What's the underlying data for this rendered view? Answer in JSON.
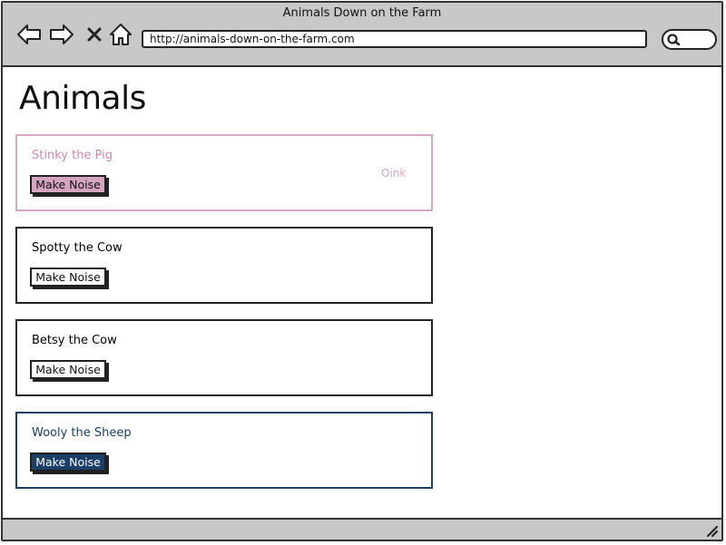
{
  "window": {
    "title": "Animals Down on the Farm"
  },
  "toolbar": {
    "back_icon": "back-arrow-icon",
    "forward_icon": "forward-arrow-icon",
    "stop_icon": "close-icon",
    "home_icon": "home-icon",
    "url": "http://animals-down-on-the-farm.com",
    "search_icon": "search-icon"
  },
  "page": {
    "title": "Animals"
  },
  "animals": [
    {
      "name": "Stinky the Pig",
      "button_label": "Make Noise",
      "noise": "Oink",
      "theme": "pink",
      "color": "#d5a4bf"
    },
    {
      "name": "Spotty the Cow",
      "button_label": "Make Noise",
      "noise": "",
      "theme": "default",
      "color": "#222222"
    },
    {
      "name": "Betsy the Cow",
      "button_label": "Make Noise",
      "noise": "",
      "theme": "default",
      "color": "#222222"
    },
    {
      "name": "Wooly the Sheep",
      "button_label": "Make Noise",
      "noise": "",
      "theme": "navy",
      "color": "#1b3f66"
    }
  ]
}
